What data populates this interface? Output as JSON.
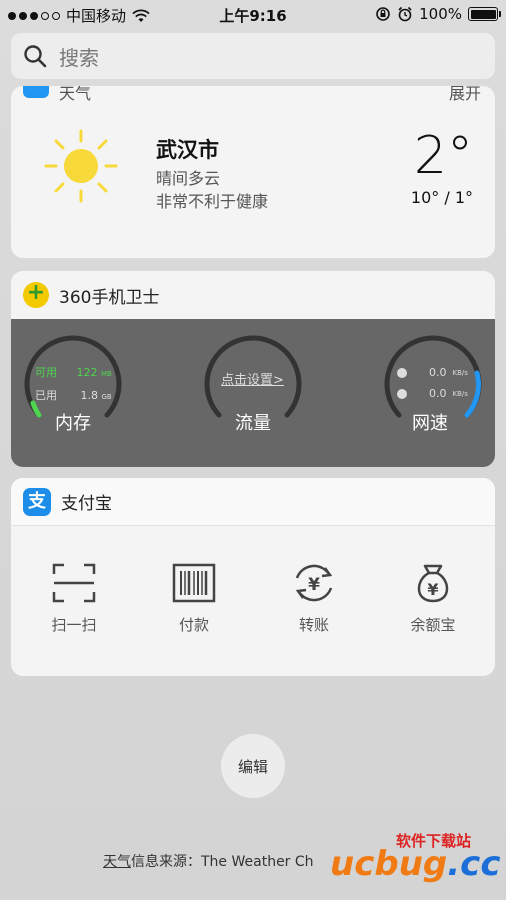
{
  "status_bar": {
    "carrier": "中国移动",
    "time": "上午9:16",
    "battery": "100%"
  },
  "search": {
    "placeholder": "搜索"
  },
  "weather": {
    "header_title": "天气",
    "header_expand": "展开",
    "city": "武汉市",
    "condition": "晴间多云",
    "advice": "非常不利于健康",
    "temperature": "2°",
    "range": "10° / 1°"
  },
  "antivirus": {
    "title": "360手机卫士",
    "memory": {
      "label": "内存",
      "available_label": "可用",
      "available_value": "122",
      "available_unit": "MB",
      "used_label": "已用",
      "used_value": "1.8",
      "used_unit": "GB"
    },
    "traffic": {
      "label": "流量",
      "link": "点击设置>"
    },
    "speed": {
      "label": "网速",
      "download": "0.0",
      "upload": "0.0",
      "unit": "KB/s"
    }
  },
  "alipay": {
    "title": "支付宝",
    "icon_glyph": "支",
    "actions": [
      {
        "label": "扫一扫",
        "icon": "scan-icon"
      },
      {
        "label": "付款",
        "icon": "barcode-icon"
      },
      {
        "label": "转账",
        "icon": "transfer-icon"
      },
      {
        "label": "余额宝",
        "icon": "money-bag-icon"
      }
    ]
  },
  "edit_button": "编辑",
  "source": {
    "link": "天气",
    "text": "信息来源：The Weather Ch"
  },
  "watermark": {
    "brand": "ucbug",
    "suffix": ".cc",
    "tagline": "软件下载站"
  },
  "colors": {
    "accent_blue": "#1c8ee9",
    "memory_green": "#4fd44f",
    "sun_yellow": "#f7d93a"
  }
}
